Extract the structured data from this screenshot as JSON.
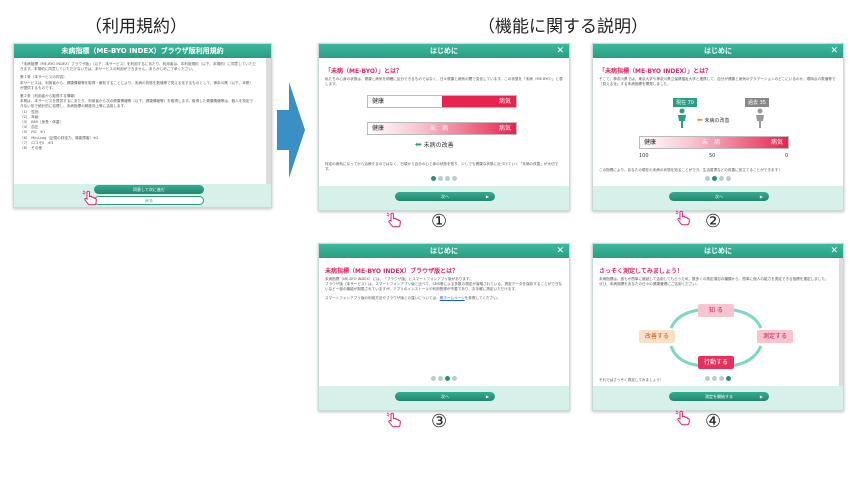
{
  "headings": {
    "terms": "（利用規約）",
    "features": "（機能に関する説明）"
  },
  "markers": [
    "①",
    "②",
    "③",
    "④"
  ],
  "terms_window": {
    "title": "未病指標（ME-BYO INDEX）ブラウザ版利用規約",
    "intro": "「未病指標（ME-BYO INDEX）ブラウザ版」（以下、本サービス）を利用するにあたり、利用者は、本利用規約（以下、本規約）に同意していただきます。本規約に同意していただけない方は、本サービスの利用ができません。あらかじめご了承ください。",
    "section1_title": "第１条（本サービスの内容）",
    "section1_text": "本サービスは、利用者から、健康情報等を取得・解析することにより、未病の状態を数値等で見える化するものとして、神奈川県（以下、本県）が提供するものです。",
    "section2_title": "第２条（利用者から取得する情報）",
    "section2_text": "本県は、本サービスを提供するにあたり、利用者から次の健康情報等（以下、健康情報等）を取得します。取得した健康情報等は、個人を特定できない形で統計的に処理し、未病指標の精度向上等に活用します。",
    "items": [
      "（1）　性別",
      "（2）　年齢",
      "（3）　BMI（身長・体重）",
      "（4）　血圧",
      "（5）　RG　※1",
      "（6）　Mini-cog（記憶の判定力、機能障害）※2",
      "（7）　ロコモ5　※3",
      "（8）　その他"
    ],
    "agree_button": "同意して次に進む",
    "back_button": "戻る"
  },
  "win1": {
    "title": "はじめに",
    "heading": "「未病（ME-BYO）」とは？",
    "text1": "私たちの心身の状態は、健康と病気を明確に区分できるものではなく、日々健康と病気の間で変化しています。この状態を「未病（ME-BYO）」と表します。",
    "bar_health": "健康",
    "bar_disease": "病気",
    "bar_mibyo": "未　病",
    "improve_label": "未病の改善",
    "text2": "特定の病気になってから治療するのではなく、日頃から自分の心と体の状態を知り、少しでも健康な状態に近づけていく「未病の改善」が大切です。",
    "next_button": "次へ"
  },
  "win2": {
    "title": "はじめに",
    "heading": "「未病指標（ME-BYO INDEX）」とは？",
    "text1": "そこで、神奈川県では、東京大学や神奈川県立保健福祉大学と連携して、自分が健康と病気のグラデーションのどこにいるのか、現時点の数値等で「見える化」する未病指標を開発しました。",
    "now_label": "現在 70",
    "past_label": "過去 35",
    "improve_label": "未病の改善",
    "bar_health": "健康",
    "bar_mibyo": "未　病",
    "bar_disease": "病気",
    "scale": [
      "100",
      "50",
      "0"
    ],
    "text2": "この指標により、あなたの現在の未病の状態を知ることができ、生活習慣などの改善に役立てることができます！",
    "next_button": "次へ"
  },
  "win3": {
    "title": "はじめに",
    "heading": "未病指標（ME-BYO INDEX）ブラウザ版とは？",
    "text1": "未病指標（ME-BYO INDEX）には、「ブラウザ版」とスマートフォンアプリ版があります。",
    "text2": "ブラウザ版（本サービス）は、スマートフォンアプリ版と比べて、SMS等による多数の測定が省略されている、測定データを保存することができないなど一部の機能が制限されていますが、アプリのインストールや利用登録が不要であり、お手軽に測定いただけます。",
    "text3": "スマートフォンアプリ版の利用方法やブラウザ版との違いについては、",
    "link_text": "県ホームページ",
    "text3b": "を参照してください。",
    "next_button": "次へ"
  },
  "win4": {
    "title": "はじめに",
    "heading": "さっそく測定してみましょう！",
    "text1": "未病指標は、誰もが簡単に継続して活用してもらうため、数多くの測定項目の種類から、簡単に個人の能力を測定できる指標を選定しました。",
    "text2": "ぜひ、未病指標をあなたの日々の健康管理にご活用ください。",
    "cycle": {
      "know": "知 る",
      "measure": "測定する",
      "act": "行動する",
      "improve": "改善する"
    },
    "text3": "それではさっそく測定してみましょう！",
    "start_button": "測定を開始する"
  },
  "colors": {
    "accent": "#2a9d82",
    "pink": "#e0245e",
    "arrow": "#3a8fc4"
  },
  "icons": [
    "hand-pointer-icon",
    "close-icon",
    "arrow-right-icon",
    "person-icon"
  ]
}
